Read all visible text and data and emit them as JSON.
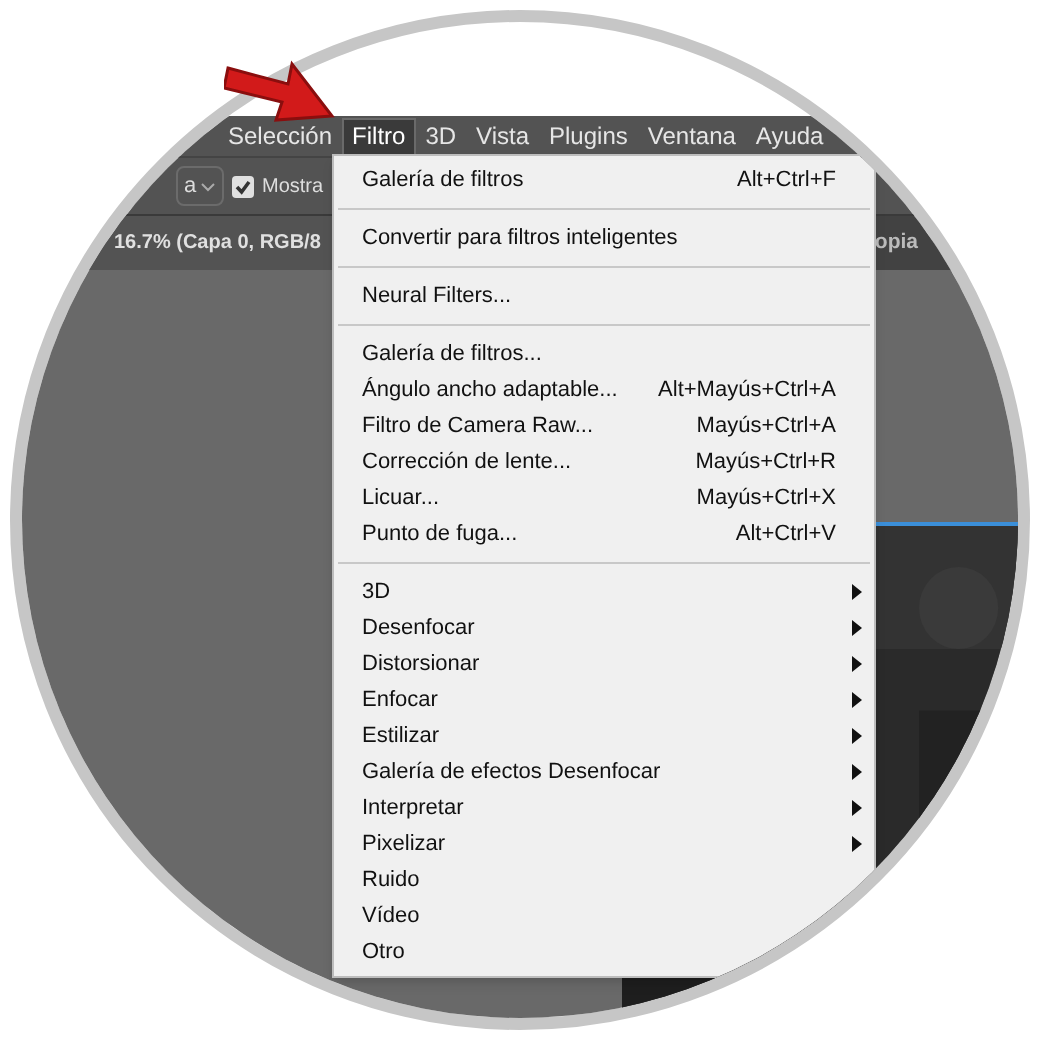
{
  "menubar": [
    {
      "label": "Selección",
      "selected": false
    },
    {
      "label": "Filtro",
      "selected": true
    },
    {
      "label": "3D",
      "selected": false
    },
    {
      "label": "Vista",
      "selected": false
    },
    {
      "label": "Plugins",
      "selected": false
    },
    {
      "label": "Ventana",
      "selected": false
    },
    {
      "label": "Ayuda",
      "selected": false
    }
  ],
  "options_bar": {
    "dropdown": "a",
    "checkbox": {
      "label": "Mostra",
      "checked": true
    }
  },
  "document_tabs": [
    {
      "title": "16.7% (Capa 0, RGB/8"
    },
    {
      "title": "opia"
    }
  ],
  "menu": {
    "groups": [
      [
        {
          "kind": "command",
          "label": "Galería de filtros",
          "shortcut": "Alt+Ctrl+F"
        }
      ],
      [
        {
          "kind": "command",
          "label": "Convertir para filtros inteligentes"
        }
      ],
      [
        {
          "kind": "command",
          "label": "Neural Filters..."
        }
      ],
      [
        {
          "kind": "command",
          "label": "Galería de filtros..."
        },
        {
          "kind": "command",
          "label": "Ángulo ancho adaptable...",
          "shortcut": "Alt+Mayús+Ctrl+A"
        },
        {
          "kind": "command",
          "label": "Filtro de Camera Raw...",
          "shortcut": "Mayús+Ctrl+A"
        },
        {
          "kind": "command",
          "label": "Corrección de lente...",
          "shortcut": "Mayús+Ctrl+R"
        },
        {
          "kind": "command",
          "label": "Licuar...",
          "shortcut": "Mayús+Ctrl+X"
        },
        {
          "kind": "command",
          "label": "Punto de fuga...",
          "shortcut": "Alt+Ctrl+V"
        }
      ],
      [
        {
          "kind": "submenu",
          "label": "3D"
        },
        {
          "kind": "submenu",
          "label": "Desenfocar"
        },
        {
          "kind": "submenu",
          "label": "Distorsionar"
        },
        {
          "kind": "submenu",
          "label": "Enfocar"
        },
        {
          "kind": "submenu",
          "label": "Estilizar"
        },
        {
          "kind": "submenu",
          "label": "Galería de efectos Desenfocar"
        },
        {
          "kind": "submenu",
          "label": "Interpretar"
        },
        {
          "kind": "submenu",
          "label": "Pixelizar"
        },
        {
          "kind": "command",
          "label": "Ruido"
        },
        {
          "kind": "command",
          "label": "Vídeo"
        },
        {
          "kind": "command",
          "label": "Otro"
        }
      ]
    ]
  }
}
